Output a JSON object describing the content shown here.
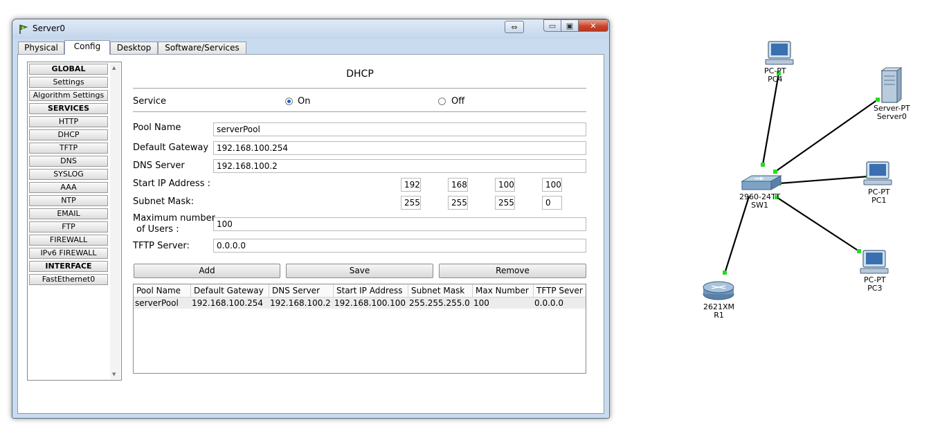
{
  "window": {
    "title": "Server0",
    "resize_icon": "⇔",
    "min_icon": "▭",
    "max_icon": "▣",
    "close_icon": "✕"
  },
  "tabs": [
    "Physical",
    "Config",
    "Desktop",
    "Software/Services"
  ],
  "active_tab": "Config",
  "left_list": [
    {
      "label": "GLOBAL",
      "header": true
    },
    {
      "label": "Settings"
    },
    {
      "label": "Algorithm Settings"
    },
    {
      "label": "SERVICES",
      "header": true
    },
    {
      "label": "HTTP"
    },
    {
      "label": "DHCP"
    },
    {
      "label": "TFTP"
    },
    {
      "label": "DNS"
    },
    {
      "label": "SYSLOG"
    },
    {
      "label": "AAA"
    },
    {
      "label": "NTP"
    },
    {
      "label": "EMAIL"
    },
    {
      "label": "FTP"
    },
    {
      "label": "FIREWALL"
    },
    {
      "label": "IPv6 FIREWALL"
    },
    {
      "label": "INTERFACE",
      "header": true
    },
    {
      "label": "FastEthernet0"
    }
  ],
  "dhcp": {
    "title": "DHCP",
    "service_label": "Service",
    "on_label": "On",
    "off_label": "Off",
    "service_on": true,
    "pool_name_label": "Pool Name",
    "pool_name": "serverPool",
    "gateway_label": "Default Gateway",
    "gateway": "192.168.100.254",
    "dns_label": "DNS Server",
    "dns": "192.168.100.2",
    "start_ip_label": "Start IP Address :",
    "start_ip": [
      "192",
      "168",
      "100",
      "100"
    ],
    "subnet_label": "Subnet Mask:",
    "subnet": [
      "255",
      "255",
      "255",
      "0"
    ],
    "max_users_label_1": "Maximum number",
    "max_users_label_2": "of Users :",
    "max_users": "100",
    "tftp_label": "TFTP Server:",
    "tftp": "0.0.0.0",
    "add_button": "Add",
    "save_button": "Save",
    "remove_button": "Remove",
    "table": {
      "columns": [
        "Pool Name",
        "Default Gateway",
        "DNS Server",
        "Start IP Address",
        "Subnet Mask",
        "Max Number",
        "TFTP Sever"
      ],
      "rows": [
        [
          "serverPool",
          "192.168.100.254",
          "192.168.100.2",
          "192.168.100.100",
          "255.255.255.0",
          "100",
          "0.0.0.0"
        ]
      ]
    }
  },
  "topology": {
    "devices": [
      {
        "id": "pc4",
        "type_label": "PC-PT",
        "name": "PC4"
      },
      {
        "id": "server0",
        "type_label": "Server-PT",
        "name": "Server0"
      },
      {
        "id": "sw1",
        "type_label": "2960-24TT",
        "name": "SW1"
      },
      {
        "id": "pc1",
        "type_label": "PC-PT",
        "name": "PC1"
      },
      {
        "id": "pc3",
        "type_label": "PC-PT",
        "name": "PC3"
      },
      {
        "id": "r1",
        "type_label": "2621XM",
        "name": "R1"
      }
    ],
    "link_color": "#000000",
    "port_color": "#22dd22"
  }
}
